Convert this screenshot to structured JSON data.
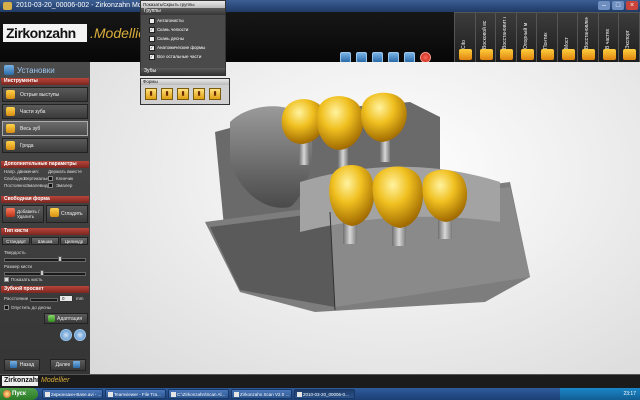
{
  "window": {
    "title": "2010-03-20_00006-002 - Zirkonzahn Modellier 3.0b2 [...]"
  },
  "header": {
    "logo": "Zirkonzahn",
    "product": ".Modellier"
  },
  "module_tabs": [
    {
      "label": "Cito",
      "icon": "crown-icon"
    },
    {
      "label": "Восковой вс",
      "icon": "wax-icon"
    },
    {
      "label": "Восстановит ле",
      "icon": "restore-icon"
    },
    {
      "label": "Опорный м",
      "icon": "abutment-icon"
    },
    {
      "label": "Понтик",
      "icon": "pontic-icon"
    },
    {
      "label": "Мост",
      "icon": "bridge-icon"
    },
    {
      "label": "Восстановление",
      "icon": "restoration-icon"
    },
    {
      "label": "В частях",
      "icon": "parts-icon"
    },
    {
      "label": "Экспорт",
      "icon": "export-icon"
    }
  ],
  "toolbar": [
    "move-icon",
    "save-icon",
    "navigate-icon",
    "camera-icon",
    "chat-icon",
    "power-icon"
  ],
  "left_panel": {
    "module_title": "Установки",
    "section_tools": "Инструменты",
    "tools": [
      {
        "label": "Острые выступы"
      },
      {
        "label": "Части зуба"
      },
      {
        "label": "Весь зуб"
      },
      {
        "label": "Гряда"
      }
    ],
    "section_extra": "Дополнительные параметры",
    "extra_cols": [
      "Напр. движения:",
      "Держать вместе"
    ],
    "extra_options": [
      "Свободно",
      "Вертикально",
      "Постоянно",
      "Эмалевидно"
    ],
    "extra_right": [
      "Клинчик",
      "Эмалер"
    ],
    "section_free": "Свободная форма",
    "free_buttons": [
      "Добавить / Удалить",
      "Сгладить"
    ],
    "section_brush": "Тип кисти",
    "brush_types": [
      "Стандарт",
      "Шишка",
      "Цилиндр"
    ],
    "hardness_label": "Твердость",
    "size_label": "Размер кисти",
    "show_brush_label": "Показать кисть",
    "section_gap": "Зубной просвет",
    "distance_label": "Расстояние",
    "distance_value": "0",
    "distance_unit": "mm",
    "lower_label": "Опустить до десны",
    "adjust_button": "Адаптация",
    "nav_back": "Назад",
    "nav_next": "Далее"
  },
  "groups_panel": {
    "title": "Показать/Скрыть группы",
    "header": "Группы",
    "items": [
      {
        "label": "Антагонисты",
        "checked": false
      },
      {
        "label": "Скань челюсти",
        "checked": true
      },
      {
        "label": "Скань десны",
        "checked": false
      },
      {
        "label": "Анатомические формы",
        "checked": true
      },
      {
        "label": "Все остальные части",
        "checked": true
      }
    ],
    "teeth_header": "Зубы"
  },
  "teeth_panel": {
    "title": "Формы",
    "buttons": [
      "crown-a-icon",
      "crown-b-icon",
      "crown-c-icon",
      "crown-d-icon",
      "crown-e-icon"
    ]
  },
  "status_bar": {
    "logo": "Zirkonzahn",
    "product": "Modellier"
  },
  "taskbar": {
    "start": "Пуск",
    "items": [
      "2ирконзахн-Base.avi - ...",
      "Teamviewer - File Tra...",
      "C:\\Zirkonzahn\\Scan Al...",
      "Zirkonzahn.Scan V2.0 ...",
      "2010-03-20_00006-0..."
    ],
    "clock": "23:17"
  }
}
